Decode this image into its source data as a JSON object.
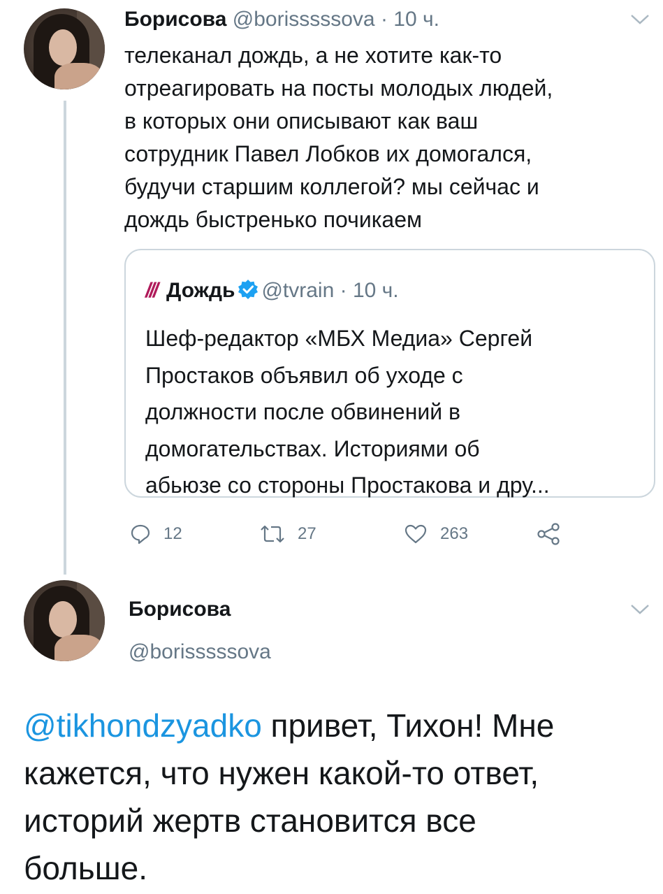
{
  "tweet1": {
    "name": "Борисова",
    "handle": "@borisssssova",
    "separator": "·",
    "time": "10 ч.",
    "lines": [
      "телеканал дождь, а не хотите как-то",
      "отреагировать на посты молодых людей,",
      "в которых они описывают как ваш",
      "сотрудник Павел Лобков их домогался,",
      "будучи старшим коллегой? мы сейчас и",
      "дождь быстренько почикаем"
    ]
  },
  "quote": {
    "logo": "///",
    "name": "Дождь",
    "handle": "@tvrain",
    "separator": "·",
    "time": "10 ч.",
    "lines": [
      "Шеф-редактор «МБХ Медиа» Сергей",
      "Простаков объявил об уходе с",
      "должности после обвинений в",
      "домогательствах. Историями об",
      "абьюзе со стороны Простакова и дру..."
    ]
  },
  "actions": {
    "replies": "12",
    "retweets": "27",
    "likes": "263"
  },
  "tweet2": {
    "name": "Борисова",
    "handle": "@borisssssova",
    "mention": "@tikhondzyadko",
    "line1_rest": " привет, Тихон! Мне",
    "lines": [
      "кажется, что нужен какой-то ответ,",
      "историй жертв становится все",
      "больше."
    ]
  },
  "colors": {
    "link": "#1b95e0",
    "secondary_text": "#657786",
    "border": "#ccd6dd",
    "verified": "#1da1f2",
    "tvrain_logo": "#b01a5a"
  },
  "icons": [
    "chevron-down-icon",
    "verified-badge-icon",
    "reply-icon",
    "retweet-icon",
    "like-icon",
    "share-icon"
  ]
}
